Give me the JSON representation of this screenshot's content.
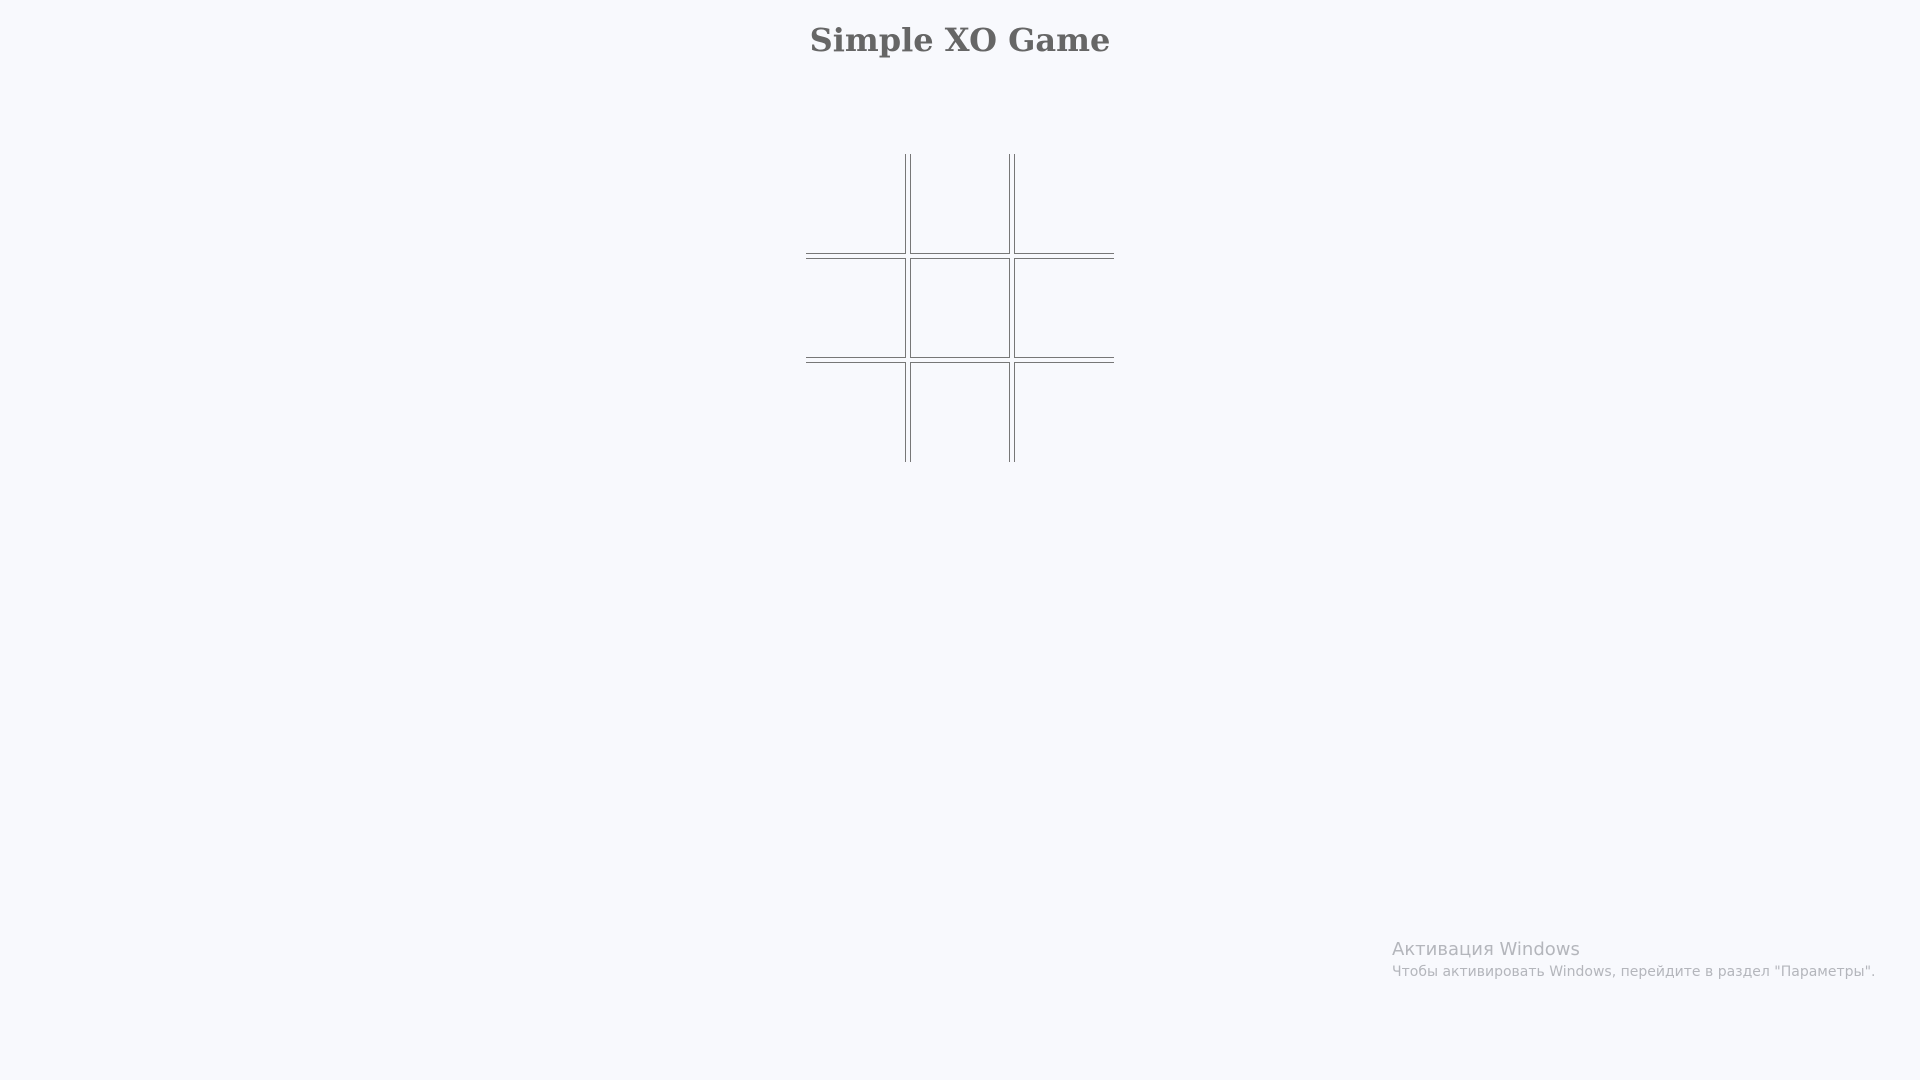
{
  "game": {
    "title": "Simple XO Game",
    "cells": [
      "",
      "",
      "",
      "",
      "",
      "",
      "",
      "",
      ""
    ]
  },
  "watermark": {
    "title": "Активация Windows",
    "subtitle": "Чтобы активировать Windows, перейдите в раздел \"Параметры\"."
  },
  "colors": {
    "background": "#f8f9fd",
    "title": "#666666",
    "grid_lines": "#777777",
    "watermark_text": "#b4b6bc"
  }
}
